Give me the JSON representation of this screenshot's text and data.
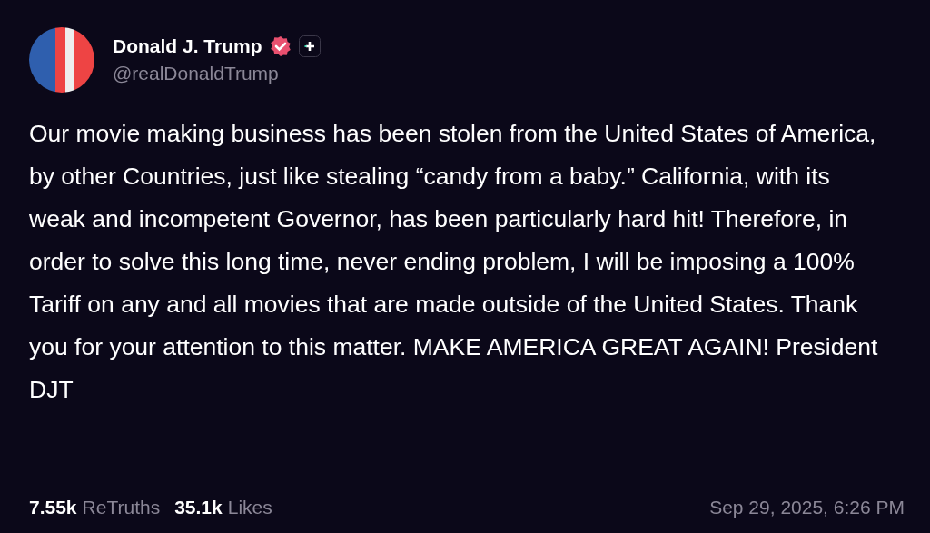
{
  "author": {
    "name": "Donald J. Trump",
    "handle": "@realDonaldTrump",
    "verified": true
  },
  "post": {
    "text": "Our movie making business has been stolen from the United States of America, by other Countries, just like stealing “candy from a baby.” California, with its weak and incompetent Governor, has been particularly hard hit! Therefore, in order to solve this long time, never ending problem, I will be imposing a 100% Tariff on any and all movies that are made outside of the United States. Thank you for your attention to this matter. MAKE AMERICA GREAT AGAIN! President DJT"
  },
  "stats": [
    {
      "count": "7.55k",
      "label": "ReTruths"
    },
    {
      "count": "35.1k",
      "label": "Likes"
    }
  ],
  "timestamp": "Sep 29, 2025, 6:26 PM"
}
